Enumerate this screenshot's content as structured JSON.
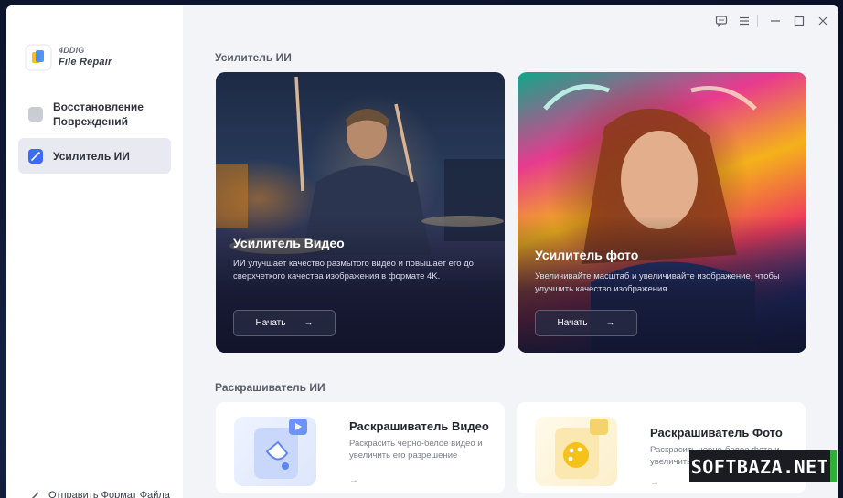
{
  "app": {
    "logo_line1": "4DDiG",
    "logo_line2": "File Repair"
  },
  "sidebar": {
    "items": [
      {
        "label": "Восстановление Повреждений",
        "icon": "folder-icon",
        "active": false
      },
      {
        "label": "Усилитель ИИ",
        "icon": "magic-wand-icon",
        "active": true
      }
    ],
    "feedback_label": "Отправить Формат Файла"
  },
  "titlebar": {
    "icons": [
      "feedback-icon",
      "menu-icon",
      "minimize-icon",
      "maximize-icon",
      "close-icon"
    ]
  },
  "enhancer": {
    "section_title": "Усилитель ИИ",
    "cards": [
      {
        "title": "Усилитель Видео",
        "description": "ИИ улучшает качество размытого видео и повышает его до сверхчеткого качества изображения в формате 4K.",
        "button_label": "Начать",
        "arrow": "→"
      },
      {
        "title": "Усилитель фото",
        "description": "Увеличивайте масштаб и увеличивайте изображение, чтобы улучшить качество изображения.",
        "button_label": "Начать",
        "arrow": "→"
      }
    ]
  },
  "colorizer": {
    "section_title": "Раскрашиватель ИИ",
    "cards": [
      {
        "title": "Раскрашиватель Видео",
        "description": "Раскрасить черно-белое видео и увеличить его разрешение",
        "arrow": "→"
      },
      {
        "title": "Раскрашиватель Фото",
        "description": "Раскрасить черно-белое фото и увеличить его разрешение",
        "arrow": "→"
      }
    ]
  },
  "watermark": "SOFTBAZA.NET",
  "colors": {
    "accent": "#3c6cf4",
    "sidebar_active_bg": "#e8e9f1",
    "watermark_green": "#2fae3a"
  }
}
